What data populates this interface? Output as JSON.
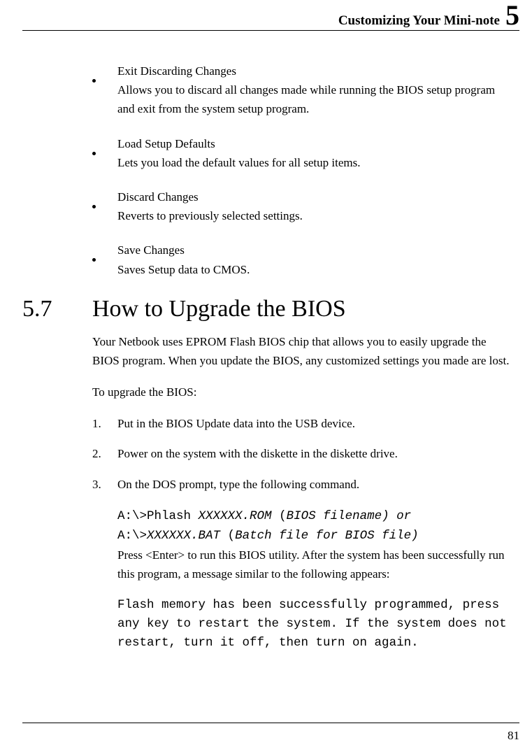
{
  "header": {
    "title": "Customizing Your Mini-note",
    "chapter": "5"
  },
  "bullets": [
    {
      "title": "Exit Discarding Changes",
      "desc": "Allows you to discard all changes made while running the BIOS setup program and exit from the system setup program."
    },
    {
      "title": "Load Setup Defaults",
      "desc": "Lets you load the default values for all setup items."
    },
    {
      "title": "Discard Changes",
      "desc": "Reverts to previously selected settings."
    },
    {
      "title": "Save Changes",
      "desc": "Saves Setup data to CMOS."
    }
  ],
  "section": {
    "num": "5.7",
    "title": "How to Upgrade the BIOS"
  },
  "intro": "Your Netbook uses EPROM Flash BIOS chip that allows you to easily upgrade the BIOS program. When you update the BIOS, any customized settings you made are lost.",
  "subhead": "To upgrade the BIOS:",
  "steps": [
    {
      "n": "1.",
      "t": "Put in the BIOS Update data into the USB device."
    },
    {
      "n": "2.",
      "t": "Power on the system with the diskette in the diskette drive."
    },
    {
      "n": "3.",
      "t": "On the DOS prompt, type the following command."
    }
  ],
  "cmd": {
    "l1a": "A:\\>Phlash ",
    "l1b": "XXXXXX.ROM ",
    "l1c": "(",
    "l1d": "BIOS filename)  or",
    "l2a": "A:\\>",
    "l2b": "XXXXXX.BAT ",
    "l2c": "(",
    "l2d": "Batch file for BIOS file)"
  },
  "after": "Press <Enter> to run this BIOS utility. After the system has been successfully run this program, a message similar to the following appears:",
  "msg": "Flash memory has been successfully programmed, press any key to restart the system. If the system does not restart, turn it off, then turn on again.",
  "page": "81"
}
